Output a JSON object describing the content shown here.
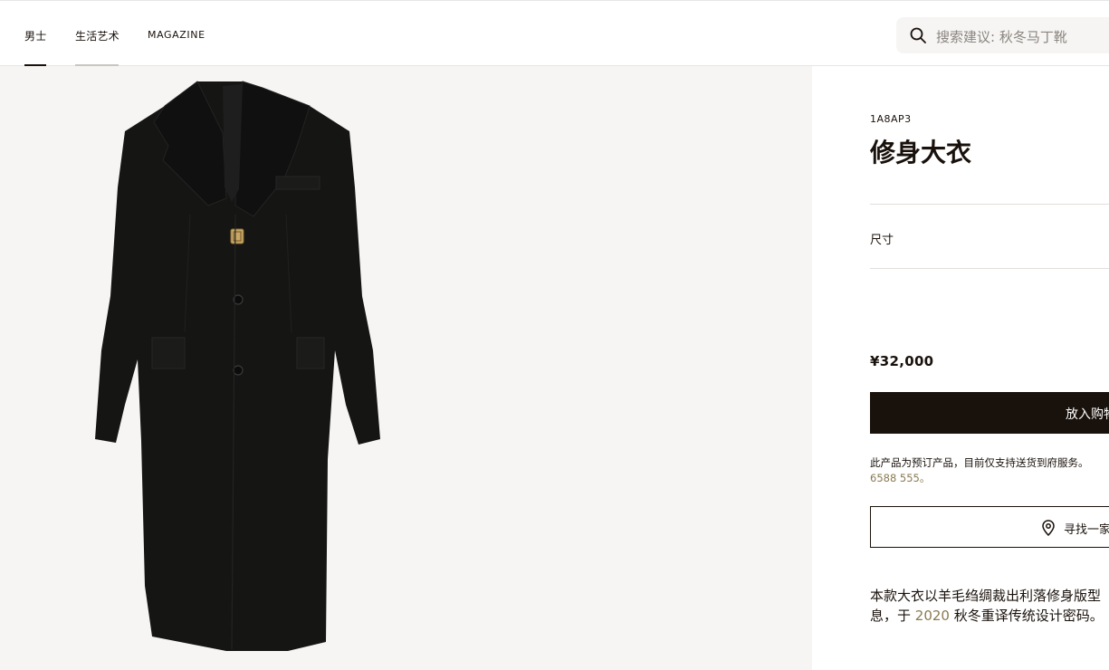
{
  "nav": {
    "items": [
      {
        "label": "男士"
      },
      {
        "label": "生活艺术"
      },
      {
        "label": "MAGAZINE"
      }
    ]
  },
  "search": {
    "placeholder": "搜索建议: 秋冬马丁靴",
    "icon": "search-icon"
  },
  "product": {
    "sku": "1A8AP3",
    "title": "修身大衣",
    "size_label": "尺寸",
    "price": "¥32,000",
    "cart_button": "放入购物",
    "notice_line1": "此产品为预订产品，目前仅支持送货到府服务。",
    "notice_line2": "6588 555。",
    "store_button": "寻找一家",
    "description_line1": "本款大衣以羊毛绉绸裁出利落修身版型",
    "description_line2_a": "息，于 ",
    "description_line2_year": "2020",
    "description_line2_b": " 秋冬重译传统设计密码。"
  },
  "colors": {
    "accent": "#19110b",
    "gallery_bg": "#f6f5f3",
    "link": "#8a7a52"
  }
}
